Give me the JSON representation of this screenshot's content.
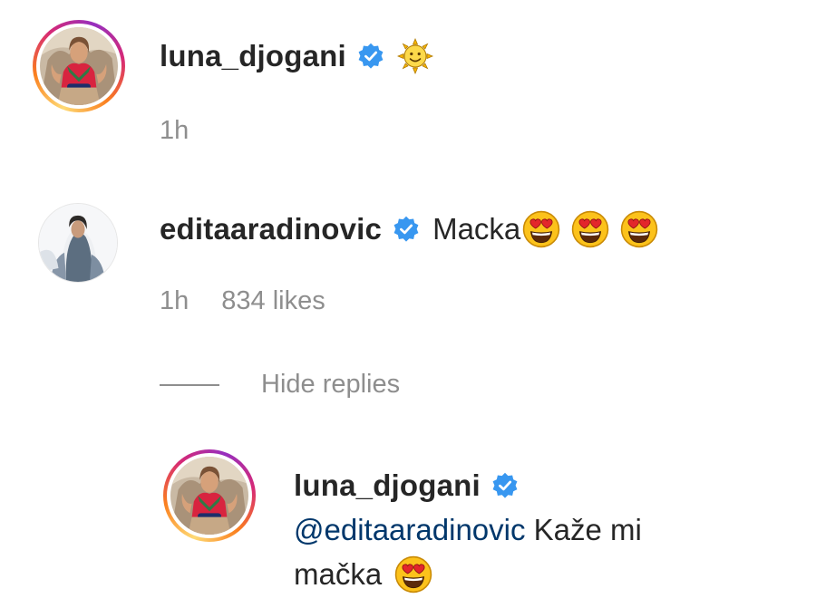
{
  "comments": [
    {
      "username": "luna_djogani",
      "verified": true,
      "text_emoji": "sun-with-face",
      "time": "1h"
    },
    {
      "username": "editaaradinovic",
      "verified": true,
      "text": "Macka",
      "emoji": [
        "heart-eyes",
        "heart-eyes",
        "heart-eyes"
      ],
      "time": "1h",
      "likes": "834 likes"
    }
  ],
  "replies_toggle": {
    "label": "Hide replies"
  },
  "reply": {
    "username": "luna_djogani",
    "verified": true,
    "mention": "@editaaradinovic",
    "text_line1_rest": " Kaže mi",
    "text_line2": "mačka",
    "emoji": "heart-eyes"
  },
  "colors": {
    "verified_blue": "#3897f0",
    "meta_gray": "#8e8e8e",
    "mention_blue": "#00376b",
    "text": "#262626"
  }
}
